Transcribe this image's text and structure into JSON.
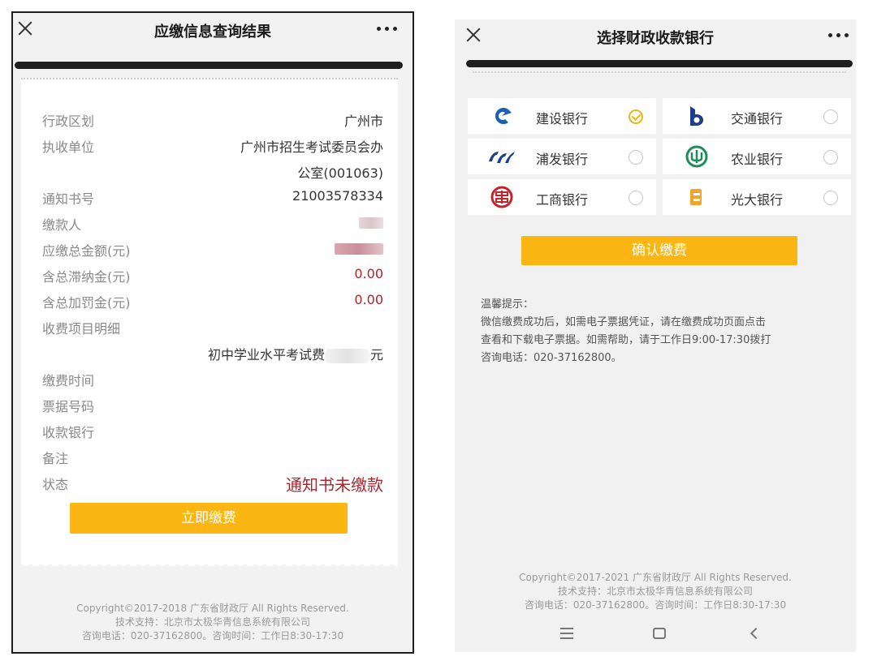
{
  "left": {
    "title": "应缴信息查询结果",
    "rows": [
      {
        "label": "行政区划",
        "value": "广州市"
      },
      {
        "label": "执收单位",
        "value": "广州市招生考试委员会办"
      },
      {
        "label": "",
        "value": "公室(001063)"
      },
      {
        "label": "通知书号",
        "value": "21003578334"
      },
      {
        "label": "缴款人",
        "value": ""
      },
      {
        "label": "应缴总金额(元)",
        "value": ""
      },
      {
        "label": "含总滞纳金(元)",
        "value": "0.00"
      },
      {
        "label": "含总加罚金(元)",
        "value": "0.00"
      },
      {
        "label": "收费项目明细",
        "value": ""
      }
    ],
    "fee_item": "初中学业水平考试费",
    "fee_unit": "元",
    "rows2": [
      {
        "label": "缴费时间",
        "value": ""
      },
      {
        "label": "票据号码",
        "value": ""
      },
      {
        "label": "收款银行",
        "value": ""
      },
      {
        "label": "备注",
        "value": ""
      },
      {
        "label": "状态",
        "value": "通知书未缴款"
      }
    ],
    "pay_button": "立即缴费",
    "footer": [
      "Copyright©2017-2018 广东省财政厅 All Rights Reserved.",
      "技术支持：北京市太极华青信息系统有限公司",
      "咨询电话：020-37162800。咨询时间：工作日8:30-17:30"
    ]
  },
  "right": {
    "title": "选择财政收款银行",
    "banks": [
      {
        "name": "建设银行",
        "selected": true,
        "logo": "ccb-logo",
        "color": "#1a5fb4"
      },
      {
        "name": "交通银行",
        "selected": false,
        "logo": "bocom-logo",
        "color": "#1d3f8a"
      },
      {
        "name": "浦发银行",
        "selected": false,
        "logo": "spdb-logo",
        "color": "#1c3e8c"
      },
      {
        "name": "农业银行",
        "selected": false,
        "logo": "abc-logo",
        "color": "#1f8a5a"
      },
      {
        "name": "工商银行",
        "selected": false,
        "logo": "icbc-logo",
        "color": "#c4232b"
      },
      {
        "name": "光大银行",
        "selected": false,
        "logo": "ceb-logo",
        "color": "#f2a52a"
      }
    ],
    "confirm_button": "确认缴费",
    "tips": [
      "温馨提示：",
      "微信缴费成功后，如需电子票据凭证，请在缴费成功页面点击",
      "查看和下载电子票据。如需帮助，请于工作日9:00-17:30拨打",
      "咨询电话：020-37162800。"
    ],
    "footer": [
      "Copyright©2017-2021 广东省财政厅 All Rights Reserved.",
      "技术支持：北京市太极华青信息系统有限公司",
      "咨询电话：020-37162800。咨询时间：工作日8:30-17:30"
    ]
  },
  "colors": {
    "accent": "#fcb614",
    "status_red": "#b4222a"
  }
}
